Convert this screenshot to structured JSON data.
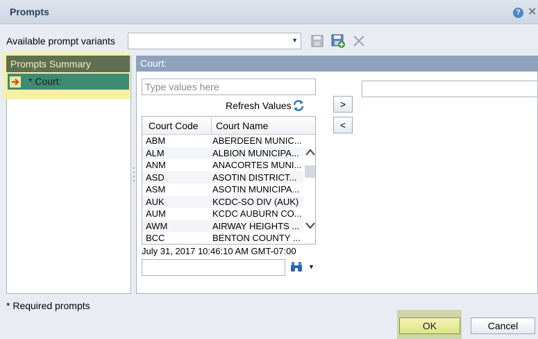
{
  "window": {
    "title": "Prompts"
  },
  "variants": {
    "label": "Available prompt variants",
    "selected": ""
  },
  "summary": {
    "header": "Prompts Summary",
    "item": "* Court:"
  },
  "court": {
    "header": "Court:",
    "type_placeholder": "Type values here",
    "refresh_label": "Refresh Values",
    "columns": [
      "Court Code",
      "Court Name"
    ],
    "rows": [
      [
        "ABM",
        "ABERDEEN MUNIC..."
      ],
      [
        "ALM",
        "ALBION MUNICIPA..."
      ],
      [
        "ANM",
        "ANACORTES MUNI..."
      ],
      [
        "ASD",
        "ASOTIN DISTRICT..."
      ],
      [
        "ASM",
        "ASOTIN MUNICIPA..."
      ],
      [
        "AUK",
        "KCDC-SO DIV (AUK)"
      ],
      [
        "AUM",
        "KCDC AUBURN CO..."
      ],
      [
        "AWM",
        "AIRWAY HEIGHTS ..."
      ],
      [
        "BCC",
        "BENTON COUNTY ..."
      ]
    ],
    "timestamp": "July 31, 2017 10:46:10 AM GMT-07:00",
    "add_label": ">",
    "remove_label": "<"
  },
  "footer": {
    "required_note": "* Required prompts",
    "ok_label": "OK",
    "cancel_label": "Cancel"
  },
  "colors": {
    "accent": "#4f86c6",
    "summary_header": "#5e6f52",
    "summary_item": "#3f8a72",
    "court_header": "#8ea1bd",
    "ok_button": "#dde483"
  }
}
